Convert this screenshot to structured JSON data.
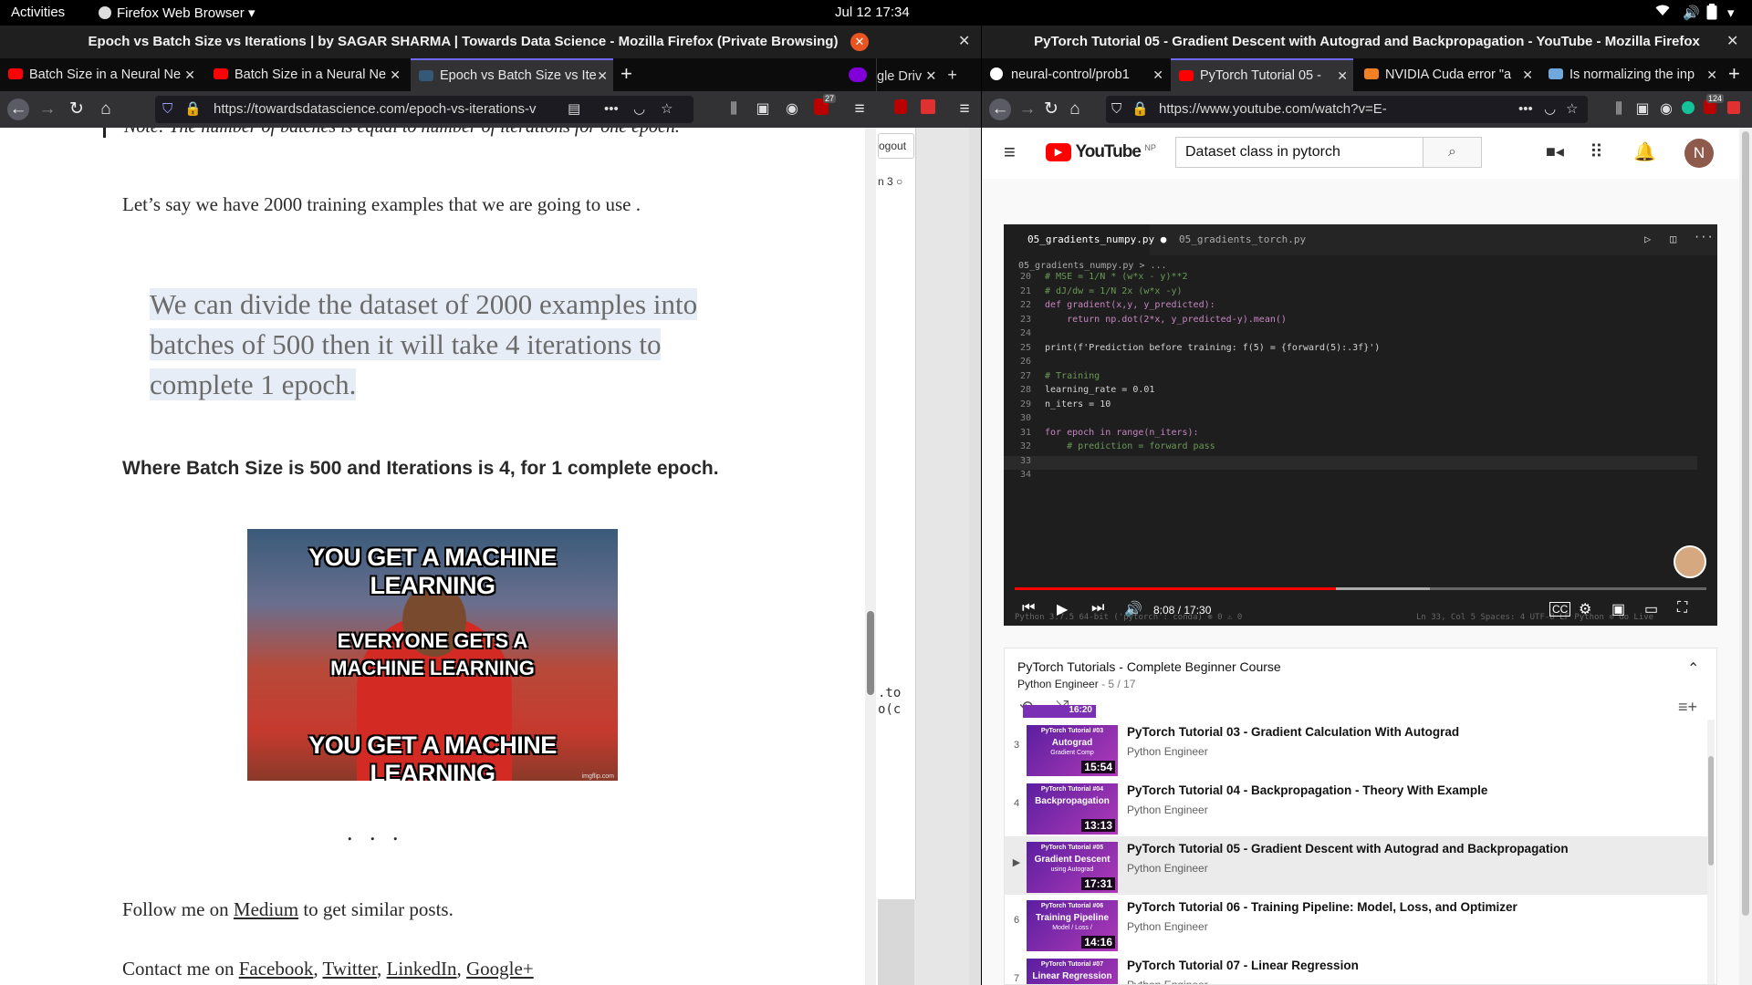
{
  "topbar": {
    "activities": "Activities",
    "app_menu": "Firefox Web Browser",
    "clock": "Jul 12  17:34"
  },
  "left_window": {
    "title": "Epoch vs Batch Size vs Iterations | by SAGAR SHARMA | Towards Data Science - Mozilla Firefox (Private Browsing)",
    "tabs": [
      {
        "label": "Batch Size in a Neural Ne",
        "favicon_color": "#ff0000"
      },
      {
        "label": "Batch Size in a Neural Ne",
        "favicon_color": "#ff0000"
      },
      {
        "label": "Epoch vs Batch Size vs Ite",
        "favicon_color": "#355876"
      }
    ],
    "url": "https://towardsdatascience.com/epoch-vs-iterations-v",
    "ublock_badge": "27",
    "behind_tab_text": "gle Driv",
    "behind_logout": "ogout",
    "behind_text2": "n 3",
    "behind_code1": ".to",
    "behind_code2": "o(c"
  },
  "article": {
    "note_partial": "Note: The number of batches is equal to number of iterations for one epoch.",
    "intro": "Let’s say we have 2000 training examples that we are going to use .",
    "quote_lines": [
      "We can divide the dataset of 2000 examples into",
      "batches of 500 then it will take 4 iterations to",
      "complete 1 epoch."
    ],
    "bold_statement": "Where Batch Size is 500 and Iterations is 4, for 1 complete epoch.",
    "meme": {
      "top": "YOU GET A MACHINE LEARNING",
      "middle_1": "EVERYONE GETS A",
      "middle_2": "MACHINE LEARNING",
      "bottom": "YOU GET A MACHINE LEARNING",
      "credit": "imgflip.com"
    },
    "separator": ". . .",
    "follow_prefix": "Follow me on ",
    "follow_link": "Medium",
    "follow_suffix": " to get similar posts.",
    "contact_prefix": "Contact me on ",
    "contact_links": [
      "Facebook",
      "Twitter",
      "LinkedIn",
      "Google+"
    ]
  },
  "right_window": {
    "title": "PyTorch Tutorial 05 - Gradient Descent with Autograd and Backpropagation - YouTube - Mozilla Firefox",
    "tabs": [
      {
        "label": "neural-control/prob1",
        "favicon_color": "#ffffff"
      },
      {
        "label": "PyTorch Tutorial 05 -",
        "favicon_color": "#ff0000"
      },
      {
        "label": "NVIDIA Cuda error \"a",
        "favicon_color": "#f48024"
      },
      {
        "label": "Is normalizing the inp",
        "favicon_color": "#6fa8dc"
      }
    ],
    "url": "https://www.youtube.com/watch?v=E-",
    "badge": "124"
  },
  "youtube": {
    "logo_text": "YouTube",
    "region": "NP",
    "search_value": "Dataset class in pytorch",
    "avatar_letter": "N",
    "player": {
      "time": "8:08 / 17:30",
      "progress_fraction": 0.465,
      "buffered_fraction": 0.6,
      "editor_tabs": [
        "05_gradients_numpy.py",
        "05_gradients_torch.py"
      ],
      "breadcrumb": "05_gradients_numpy.py > ...",
      "code_lines": [
        {
          "n": "20",
          "t": "# MSE = 1/N * (w*x - y)**2"
        },
        {
          "n": "21",
          "t": "# dJ/dw = 1/N 2x (w*x -y)"
        },
        {
          "n": "22",
          "t": "def gradient(x,y, y_predicted):"
        },
        {
          "n": "23",
          "t": "    return np.dot(2*x, y_predicted-y).mean()"
        },
        {
          "n": "24",
          "t": ""
        },
        {
          "n": "25",
          "t": "print(f'Prediction before training: f(5) = {forward(5):.3f}')"
        },
        {
          "n": "26",
          "t": ""
        },
        {
          "n": "27",
          "t": "# Training"
        },
        {
          "n": "28",
          "t": "learning_rate = 0.01"
        },
        {
          "n": "29",
          "t": "n_iters = 10"
        },
        {
          "n": "30",
          "t": ""
        },
        {
          "n": "31",
          "t": "for epoch in range(n_iters):"
        },
        {
          "n": "32",
          "t": "    # prediction = forward pass"
        },
        {
          "n": "33",
          "t": ""
        },
        {
          "n": "34",
          "t": ""
        }
      ],
      "statusbar_left": "Python 3.7.5 64-bit ('pytorch': conda)   ⊗ 0 ⚠ 0",
      "statusbar_right": "Ln 33, Col 5    Spaces: 4    UTF-8    LF    Python    ⊙ Go Live"
    },
    "playlist": {
      "title": "PyTorch Tutorials - Complete Beginner Course",
      "channel": "Python Engineer",
      "position": "5 / 17",
      "partial_duration": "16:20",
      "items": [
        {
          "index": "3",
          "title": "PyTorch Tutorial 03 - Gradient Calculation With Autograd",
          "channel": "Python Engineer",
          "duration": "15:54",
          "thumb_label": "PyTorch Tutorial #03",
          "thumb_title": "Autograd",
          "thumb_sub": "Gradient Comp"
        },
        {
          "index": "4",
          "title": "PyTorch Tutorial 04 - Backpropagation - Theory With Example",
          "channel": "Python Engineer",
          "duration": "13:13",
          "thumb_label": "PyTorch Tutorial #04",
          "thumb_title": "Backpropagation",
          "thumb_sub": ""
        },
        {
          "index": "▶",
          "title": "PyTorch Tutorial 05 - Gradient Descent with Autograd and Backpropagation",
          "channel": "Python Engineer",
          "duration": "17:31",
          "thumb_label": "PyTorch Tutorial #05",
          "thumb_title": "Gradient Descent",
          "thumb_sub": "using Autograd"
        },
        {
          "index": "6",
          "title": "PyTorch Tutorial 06 - Training Pipeline: Model, Loss, and Optimizer",
          "channel": "Python Engineer",
          "duration": "14:16",
          "thumb_label": "PyTorch Tutorial #06",
          "thumb_title": "Training Pipeline",
          "thumb_sub": "Model / Loss /"
        },
        {
          "index": "7",
          "title": "PyTorch Tutorial 07 - Linear Regression",
          "channel": "Python Engineer",
          "duration": "",
          "thumb_label": "PyTorch Tutorial #07",
          "thumb_title": "Linear Regression",
          "thumb_sub": ""
        }
      ]
    }
  }
}
